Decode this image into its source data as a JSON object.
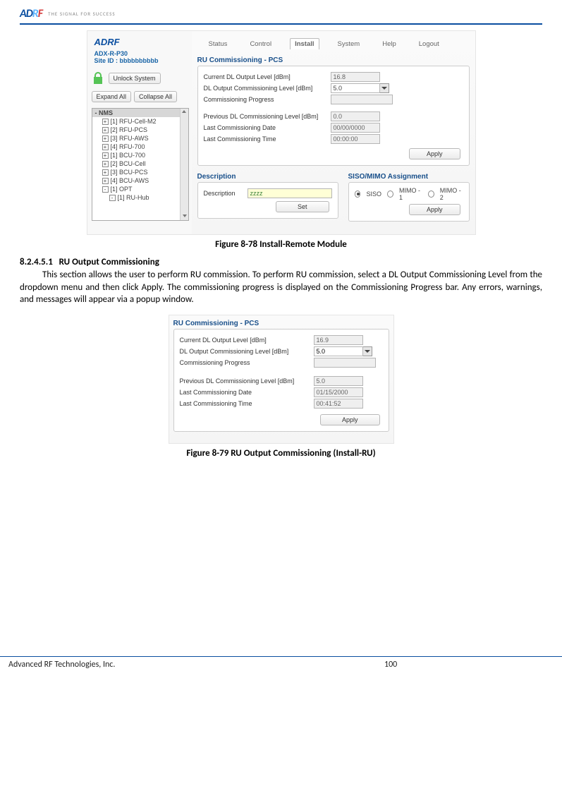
{
  "header": {
    "brand": "AD",
    "brand_r": "R",
    "brand_f": "F",
    "tagline": "THE SIGNAL FOR SUCCESS"
  },
  "shot1": {
    "product": "ADX-R-P30",
    "site_id_label": "Site ID :",
    "site_id": "bbbbbbbbbb",
    "unlock": "Unlock System",
    "expand": "Expand All",
    "collapse": "Collapse All",
    "tree_header": "NMS",
    "tree": [
      "[1] RFU-Cell-M2",
      "[2] RFU-PCS",
      "[3] RFU-AWS",
      "[4] RFU-700",
      "[1] BCU-700",
      "[2] BCU-Cell",
      "[3] BCU-PCS",
      "[4] BCU-AWS",
      "[1] OPT",
      "[1] RU-Hub"
    ],
    "nav": [
      "Status",
      "Control",
      "Install",
      "System",
      "Help",
      "Logout"
    ],
    "panel_title": "RU Commissioning - PCS",
    "rows": {
      "r1l": "Current DL Output Level [dBm]",
      "r1v": "16.8",
      "r2l": "DL Output Commissioning Level [dBm]",
      "r2v": "5.0",
      "r3l": "Commissioning Progress",
      "r4l": "Previous DL Commissioning Level [dBm]",
      "r4v": "0.0",
      "r5l": "Last Commissioning Date",
      "r5v": "00/00/0000",
      "r6l": "Last Commissioning Time",
      "r6v": "00:00:00"
    },
    "apply": "Apply",
    "desc_title": "Description",
    "desc_label": "Description",
    "desc_val": "zzzz",
    "set": "Set",
    "siso_title": "SISO/MIMO Assignment",
    "opt_siso": "SISO",
    "opt_m1": "MIMO - 1",
    "opt_m2": "MIMO - 2"
  },
  "caption1": "Figure 8-78    Install-Remote Module",
  "section_no": "8.2.4.5.1",
  "section_title": "RU Output Commissioning",
  "para": "This section allows the user to perform RU commission. To perform RU commission, select a DL Output Commissioning Level from the dropdown menu and then click Apply. The commissioning progress is displayed on the Commissioning Progress bar.  Any errors, warnings, and messages will appear via a popup window.",
  "shot2": {
    "panel_title": "RU Commissioning - PCS",
    "r1l": "Current DL Output Level [dBm]",
    "r1v": "16.9",
    "r2l": "DL Output Commissioning Level [dBm]",
    "r2v": "5.0",
    "r3l": "Commissioning Progress",
    "r4l": "Previous DL Commissioning Level [dBm]",
    "r4v": "5.0",
    "r5l": "Last Commissioning Date",
    "r5v": "01/15/2000",
    "r6l": "Last Commissioning Time",
    "r6v": "00:41:52",
    "apply": "Apply"
  },
  "caption2": "Figure 8-79    RU Output Commissioning (Install-RU)",
  "footer": {
    "company": "Advanced RF Technologies, Inc.",
    "page": "100"
  }
}
